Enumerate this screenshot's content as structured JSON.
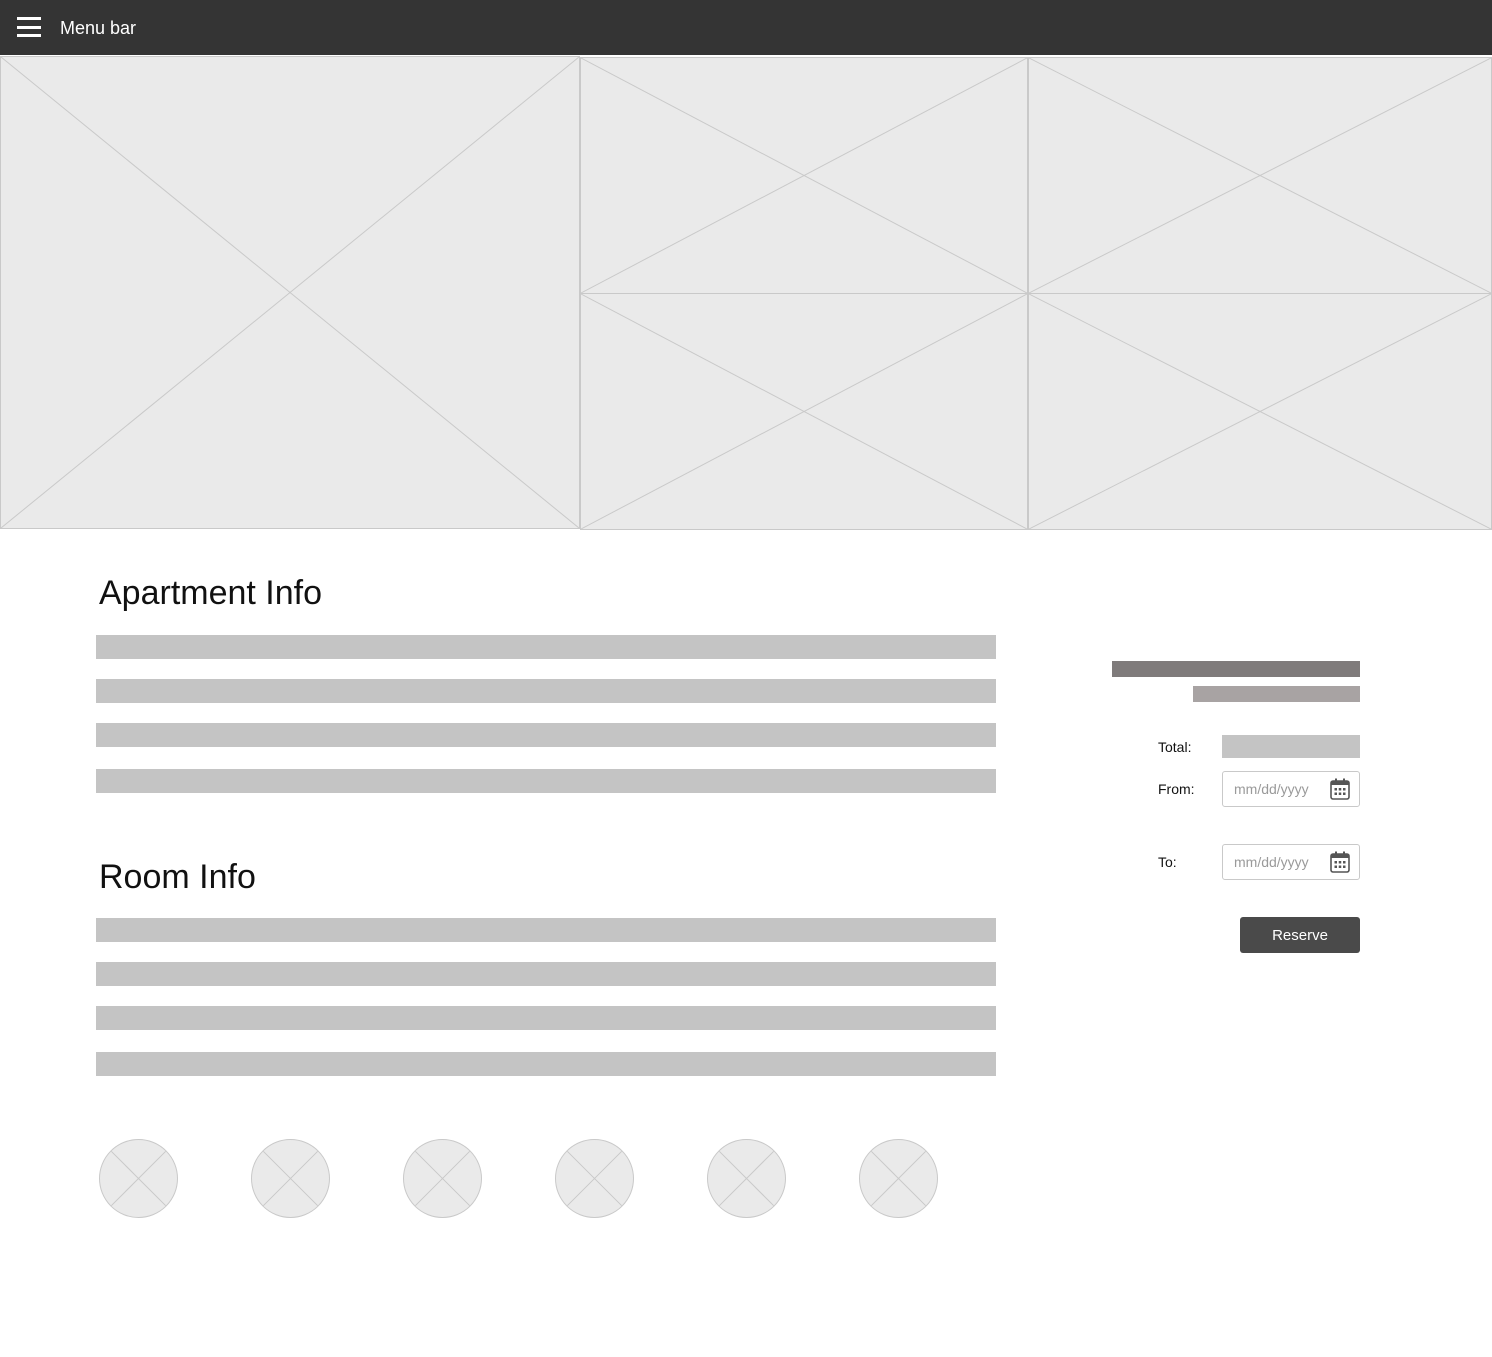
{
  "menubar": {
    "title": "Menu bar",
    "menu_icon": "hamburger-menu-icon",
    "background": "#343434"
  },
  "gallery": {
    "images": [
      {
        "name": "gallery-image-main"
      },
      {
        "name": "gallery-image-top-middle"
      },
      {
        "name": "gallery-image-top-right"
      },
      {
        "name": "gallery-image-bottom-middle"
      },
      {
        "name": "gallery-image-bottom-right"
      }
    ]
  },
  "apartment": {
    "heading": "Apartment Info",
    "text_lines": 4
  },
  "room": {
    "heading": "Room Info",
    "text_lines": 4
  },
  "booking": {
    "total_label": "Total:",
    "from_label": "From:",
    "to_label": "To:",
    "from_placeholder": "mm/dd/yyyy",
    "to_placeholder": "mm/dd/yyyy",
    "calendar_icon": "calendar-icon",
    "reserve_label": "Reserve",
    "button_color": "#4a4a4a"
  },
  "amenities": {
    "count": 6
  }
}
